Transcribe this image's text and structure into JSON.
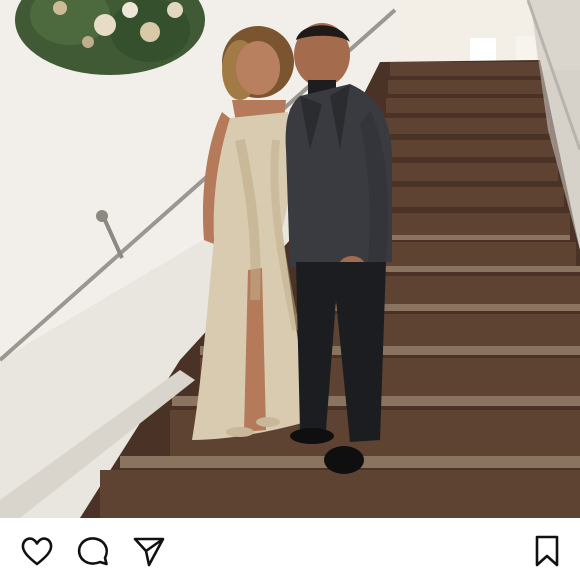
{
  "post": {
    "photo": {
      "alt": "",
      "palette": {
        "wall": "#ece8e2",
        "stair_carpet": "#5c3f2f",
        "stair_edge": "#7a6450",
        "dress": "#d8cbb0",
        "suit": "#2f3034",
        "skin": "#b47a5a",
        "wreath": "#3f5a35"
      }
    },
    "actions": {
      "like": {
        "icon": "heart-icon"
      },
      "comment": {
        "icon": "comment-icon"
      },
      "share": {
        "icon": "send-icon"
      },
      "save": {
        "icon": "bookmark-icon"
      }
    }
  }
}
